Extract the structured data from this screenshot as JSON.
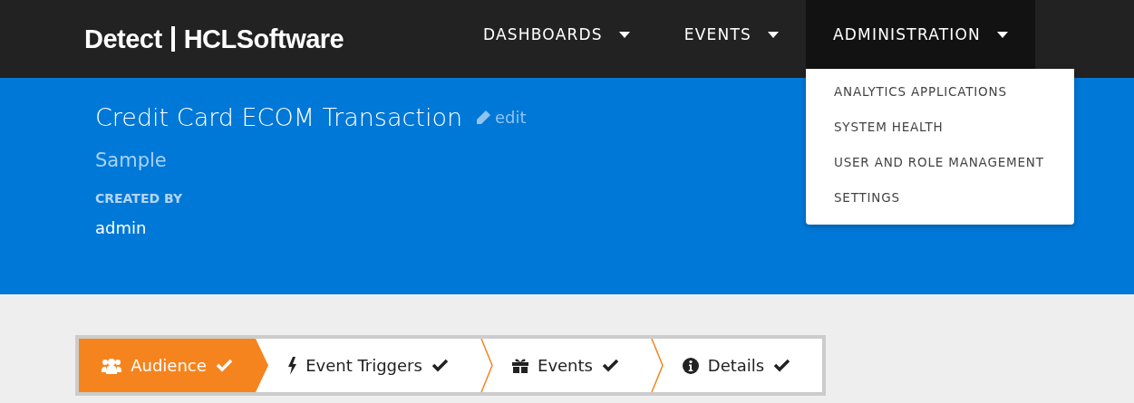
{
  "header": {
    "logo_product": "Detect",
    "logo_brand": "HCLSoftware",
    "nav": [
      {
        "label": "DASHBOARDS",
        "selected": false
      },
      {
        "label": "EVENTS",
        "selected": false
      },
      {
        "label": "ADMINISTRATION",
        "selected": true,
        "menu": [
          "ANALYTICS APPLICATIONS",
          "SYSTEM HEALTH",
          "USER AND ROLE MANAGEMENT",
          "SETTINGS"
        ]
      }
    ]
  },
  "summary": {
    "title": "Credit Card ECOM Transaction",
    "edit_link": "edit",
    "subtitle": "Sample",
    "created_by_label": "CREATED BY",
    "created_by": "admin"
  },
  "steps": [
    {
      "label": "Audience",
      "kind": "audience",
      "selected": true,
      "done": true
    },
    {
      "label": "Event Triggers",
      "kind": "triggers",
      "selected": false,
      "done": true
    },
    {
      "label": "Events",
      "kind": "events",
      "selected": false,
      "done": true
    },
    {
      "label": "Details",
      "kind": "details",
      "selected": false,
      "done": true
    }
  ]
}
